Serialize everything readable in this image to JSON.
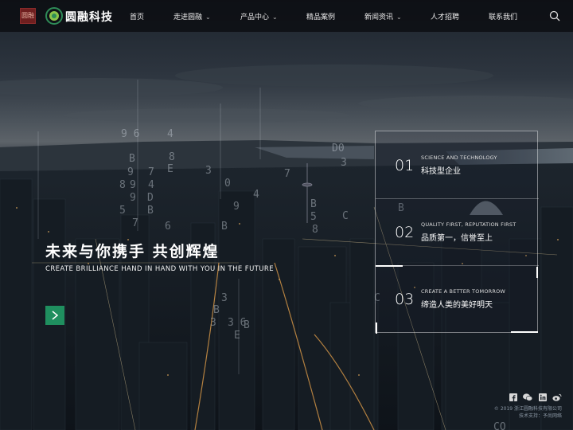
{
  "brand": {
    "seal_text": "圆融",
    "name": "圆融科技",
    "accent_color": "#1f8f5f"
  },
  "nav": {
    "items": [
      {
        "label": "首页",
        "has_dropdown": false
      },
      {
        "label": "走进圆融",
        "has_dropdown": true
      },
      {
        "label": "产品中心",
        "has_dropdown": true
      },
      {
        "label": "精品案例",
        "has_dropdown": false
      },
      {
        "label": "新闻资讯",
        "has_dropdown": true
      },
      {
        "label": "人才招聘",
        "has_dropdown": false
      },
      {
        "label": "联系我们",
        "has_dropdown": false
      }
    ],
    "search_icon": "search-icon"
  },
  "hero": {
    "title": "未来与你携手 共创辉煌",
    "subtitle": "CREATE BRILLIANCE HAND IN HAND WITH YOU IN THE FUTURE",
    "button_icon": "arrow-right-icon"
  },
  "features": [
    {
      "number": "01",
      "en": "SCIENCE AND TECHNOLOGY",
      "zh": "科技型企业"
    },
    {
      "number": "02",
      "en": "QUALITY FIRST, REPUTATION FIRST",
      "zh": "品质第一，信誉至上"
    },
    {
      "number": "03",
      "en": "CREATE A BETTER TOMORROW",
      "zh": "缔造人类的美好明天"
    }
  ],
  "footer": {
    "social_icons": [
      "facebook-icon",
      "wechat-icon",
      "linkedin-icon",
      "weibo-icon"
    ],
    "copyright": "© 2019 浙江圆融科技有限公司",
    "support": "技术支持：予尚网络"
  }
}
